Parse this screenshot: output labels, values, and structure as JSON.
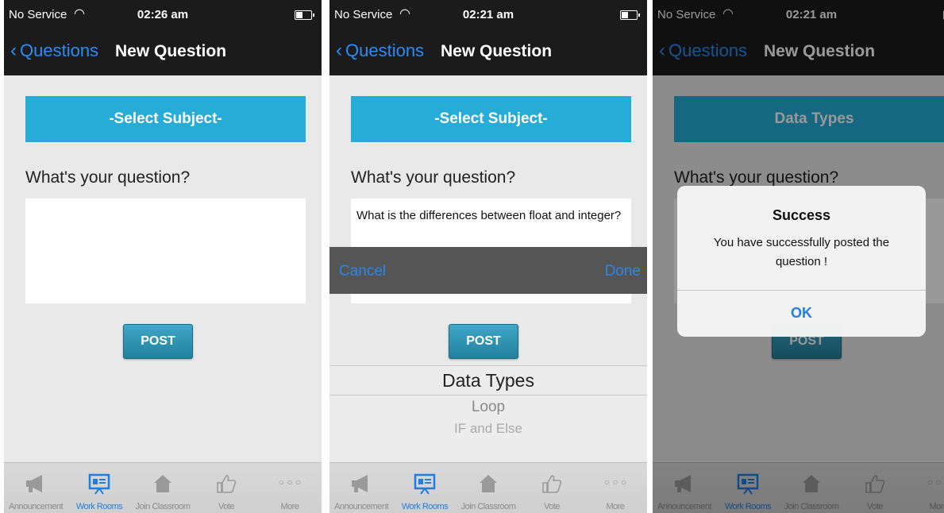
{
  "status": {
    "carrier": "No Service",
    "wifi_icon": "wifi-icon"
  },
  "panels": [
    {
      "time": "02:26 am",
      "nav": {
        "back": "Questions",
        "title": "New Question"
      },
      "subject": "-Select Subject-",
      "question_label": "What's your question?",
      "question_text": "",
      "post": "POST",
      "tabs": [
        "Announcement",
        "Work Rooms",
        "Join Classroom",
        "Vote",
        "More"
      ]
    },
    {
      "time": "02:21 am",
      "nav": {
        "back": "Questions",
        "title": "New Question"
      },
      "subject": "-Select Subject-",
      "question_label": "What's your question?",
      "question_text": "What is the differences between float and integer?",
      "post": "POST",
      "toolbar": {
        "cancel": "Cancel",
        "done": "Done"
      },
      "picker": [
        "Data Types",
        "Loop",
        "IF and Else"
      ],
      "tabs": [
        "Announcement",
        "Work Rooms",
        "Join Classroom",
        "Vote",
        "More"
      ]
    },
    {
      "time": "02:21 am",
      "nav": {
        "back": "Questions",
        "title": "New Question"
      },
      "subject": "Data Types",
      "question_label": "What's your question?",
      "post": "POST",
      "alert": {
        "title": "Success",
        "message": "You have successfully posted the question !",
        "ok": "OK"
      },
      "tabs": [
        "Announcement",
        "Work Rooms",
        "Join Classroom",
        "Vote",
        "More"
      ]
    }
  ],
  "colors": {
    "accent": "#1f7fe0",
    "subject_bg": "#26acd7",
    "bar_bg": "#1b1b1b"
  }
}
